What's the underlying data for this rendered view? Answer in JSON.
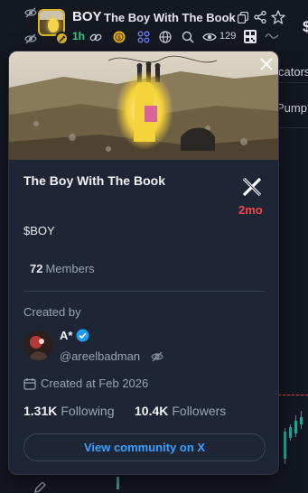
{
  "header": {
    "ticker": "BOY",
    "token_name": "The Boy With The Book",
    "age": "1h",
    "views": "129",
    "icons": [
      "eye-off-icon",
      "copy-icon",
      "share-icon",
      "star-icon",
      "link-icon",
      "coin-icon",
      "holders-icon",
      "globe-icon",
      "search-icon",
      "eye-icon",
      "qr-icon",
      "wave-icon"
    ]
  },
  "background": {
    "currency_symbol": "$",
    "text_fragments": [
      "cators",
      "Pump"
    ]
  },
  "card": {
    "title": "The Boy With The Book",
    "age": "2mo",
    "symbol": "$BOY",
    "members_count": "72",
    "members_label": "Members",
    "created_by_label": "Created by",
    "creator": {
      "name": "A*",
      "handle": "@areelbadman"
    },
    "created_at": "Created at Feb 2026",
    "following_count": "1.31K",
    "following_label": "Following",
    "followers_count": "10.4K",
    "followers_label": "Followers",
    "view_button": "View community on X"
  },
  "colors": {
    "accent_green": "#2fd089",
    "accent_red": "#f2474e",
    "link_blue": "#3aa0ff",
    "card_bg": "#1e2635"
  }
}
